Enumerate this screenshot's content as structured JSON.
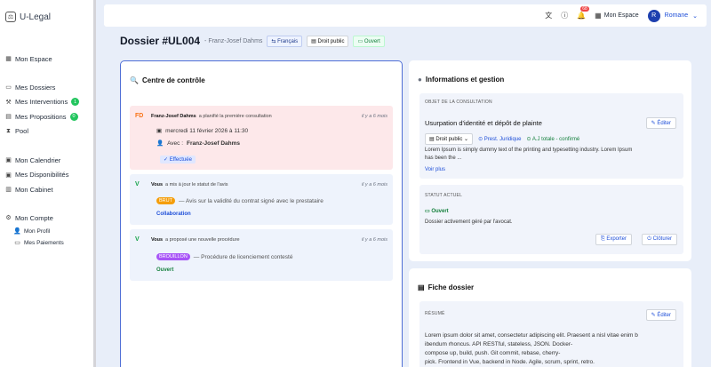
{
  "app": {
    "name": "U-Legal"
  },
  "sidebar": {
    "items": [
      {
        "label": "Mon Espace"
      },
      {
        "label": "Mes Dossiers"
      },
      {
        "label": "Mes Interventions",
        "badge": "1"
      },
      {
        "label": "Mes Propositions",
        "badge": "0"
      },
      {
        "label": "Pool"
      },
      {
        "label": "Mon Calendrier"
      },
      {
        "label": "Mes Disponibilités"
      },
      {
        "label": "Mon Cabinet"
      },
      {
        "label": "Mon Compte"
      },
      {
        "label": "Mon Profil"
      },
      {
        "label": "Mes Paiements"
      }
    ]
  },
  "topbar": {
    "notif_count": "68",
    "espace_label": "Mon Espace",
    "avatar_initial": "R",
    "user_name": "Romane"
  },
  "header": {
    "title": "Dossier #UL004",
    "client": "- Franz-Josef Dahms",
    "lang_chip": "Français",
    "access_chip": "Droit public",
    "status_chip": "Ouvert"
  },
  "activity": {
    "title": "Centre de contrôle",
    "items": [
      {
        "initials": "FD",
        "who": "Franz-Josef Dahms",
        "what": "a planifié la première consultation",
        "when": "il y a 6 mois",
        "date": "mercredi 11 février 2026 à 11:30",
        "with_label": "Avec :",
        "with_name": "Franz-Josef Dahms",
        "status": "Effectuée"
      },
      {
        "initials": "V",
        "who": "Vous",
        "what": "a mis à jour le statut de l'avis",
        "when": "il y a 6 mois",
        "tag": "BRUT",
        "desc": "— Avis sur la validité du contrat signé avec le prestataire",
        "category": "Collaboration"
      },
      {
        "initials": "V",
        "who": "Vous",
        "what": "a proposé une nouvelle procédure",
        "when": "il y a 6 mois",
        "tag": "BROUILLON",
        "desc": "— Procédure de licenciement contesté",
        "category": "Ouvert"
      }
    ]
  },
  "info": {
    "title": "Informations et gestion",
    "object_caption": "OBJET DE LA CONSULTATION",
    "object_title": "Usurpation d'identité et dépôt de plainte",
    "edit_label": "Éditer",
    "domain_select": "Droit public",
    "prest_label": "Prest. Juridique",
    "aj_label": "A.J totale - confirmé",
    "desc_1": "Lorem Ipsum is simply dummy text of the printing and typesetting industry. Lorem Ipsum",
    "desc_2": "has been the ...",
    "see_more": "Voir plus",
    "status_caption": "STATUT ACTUEL",
    "status_chip": "Ouvert",
    "status_desc": "Dossier activement géré par l'avocat.",
    "export_label": "Exporter",
    "close_label": "Clôturer"
  },
  "fiche": {
    "title": "Fiche dossier",
    "resume_caption": "RÉSUMÉ",
    "edit_label": "Éditer",
    "lines": [
      "Lorem ipsum dolor sit amet, consectetur adipiscing elit. Praesent a nisl vitae enim b",
      "ibendum rhoncus. API RESTful, stateless, JSON. Docker-",
      "compose up, build, push. Git commit, rebase, cherry-",
      "pick. Frontend in Vue, backend in Node. Agile, scrum, sprint, retro."
    ]
  }
}
